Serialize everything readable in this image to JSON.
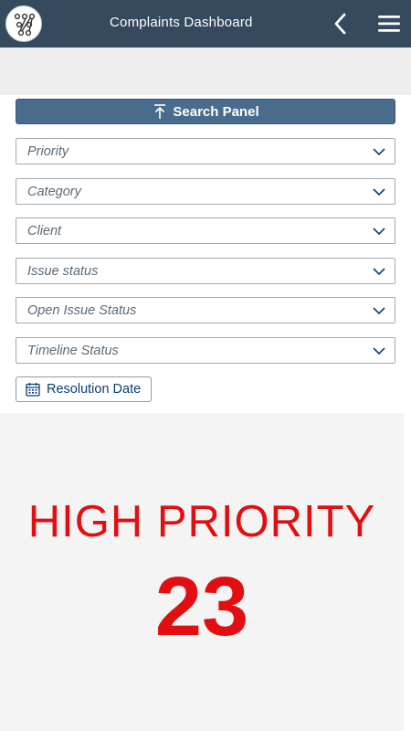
{
  "header": {
    "title": "Complaints Dashboard"
  },
  "search_panel": {
    "label": "Search Panel"
  },
  "filters": [
    {
      "placeholder": "Priority"
    },
    {
      "placeholder": "Category"
    },
    {
      "placeholder": "Client"
    },
    {
      "placeholder": "Issue status"
    },
    {
      "placeholder": "Open Issue Status"
    },
    {
      "placeholder": "Timeline Status"
    }
  ],
  "date_filter": {
    "label": "Resolution Date"
  },
  "kpi": {
    "label": "HIGH PRIORITY",
    "value": "23"
  },
  "colors": {
    "header_bg": "#354a5f",
    "search_panel_bg": "#4a6c8c",
    "kpi_text": "#e20f12",
    "kpi_bg": "#f4f4f4"
  },
  "icons": [
    "app-logo-icon",
    "back-chevron-icon",
    "hamburger-menu-icon",
    "collapse-up-icon",
    "chevron-down-icon",
    "calendar-icon"
  ]
}
